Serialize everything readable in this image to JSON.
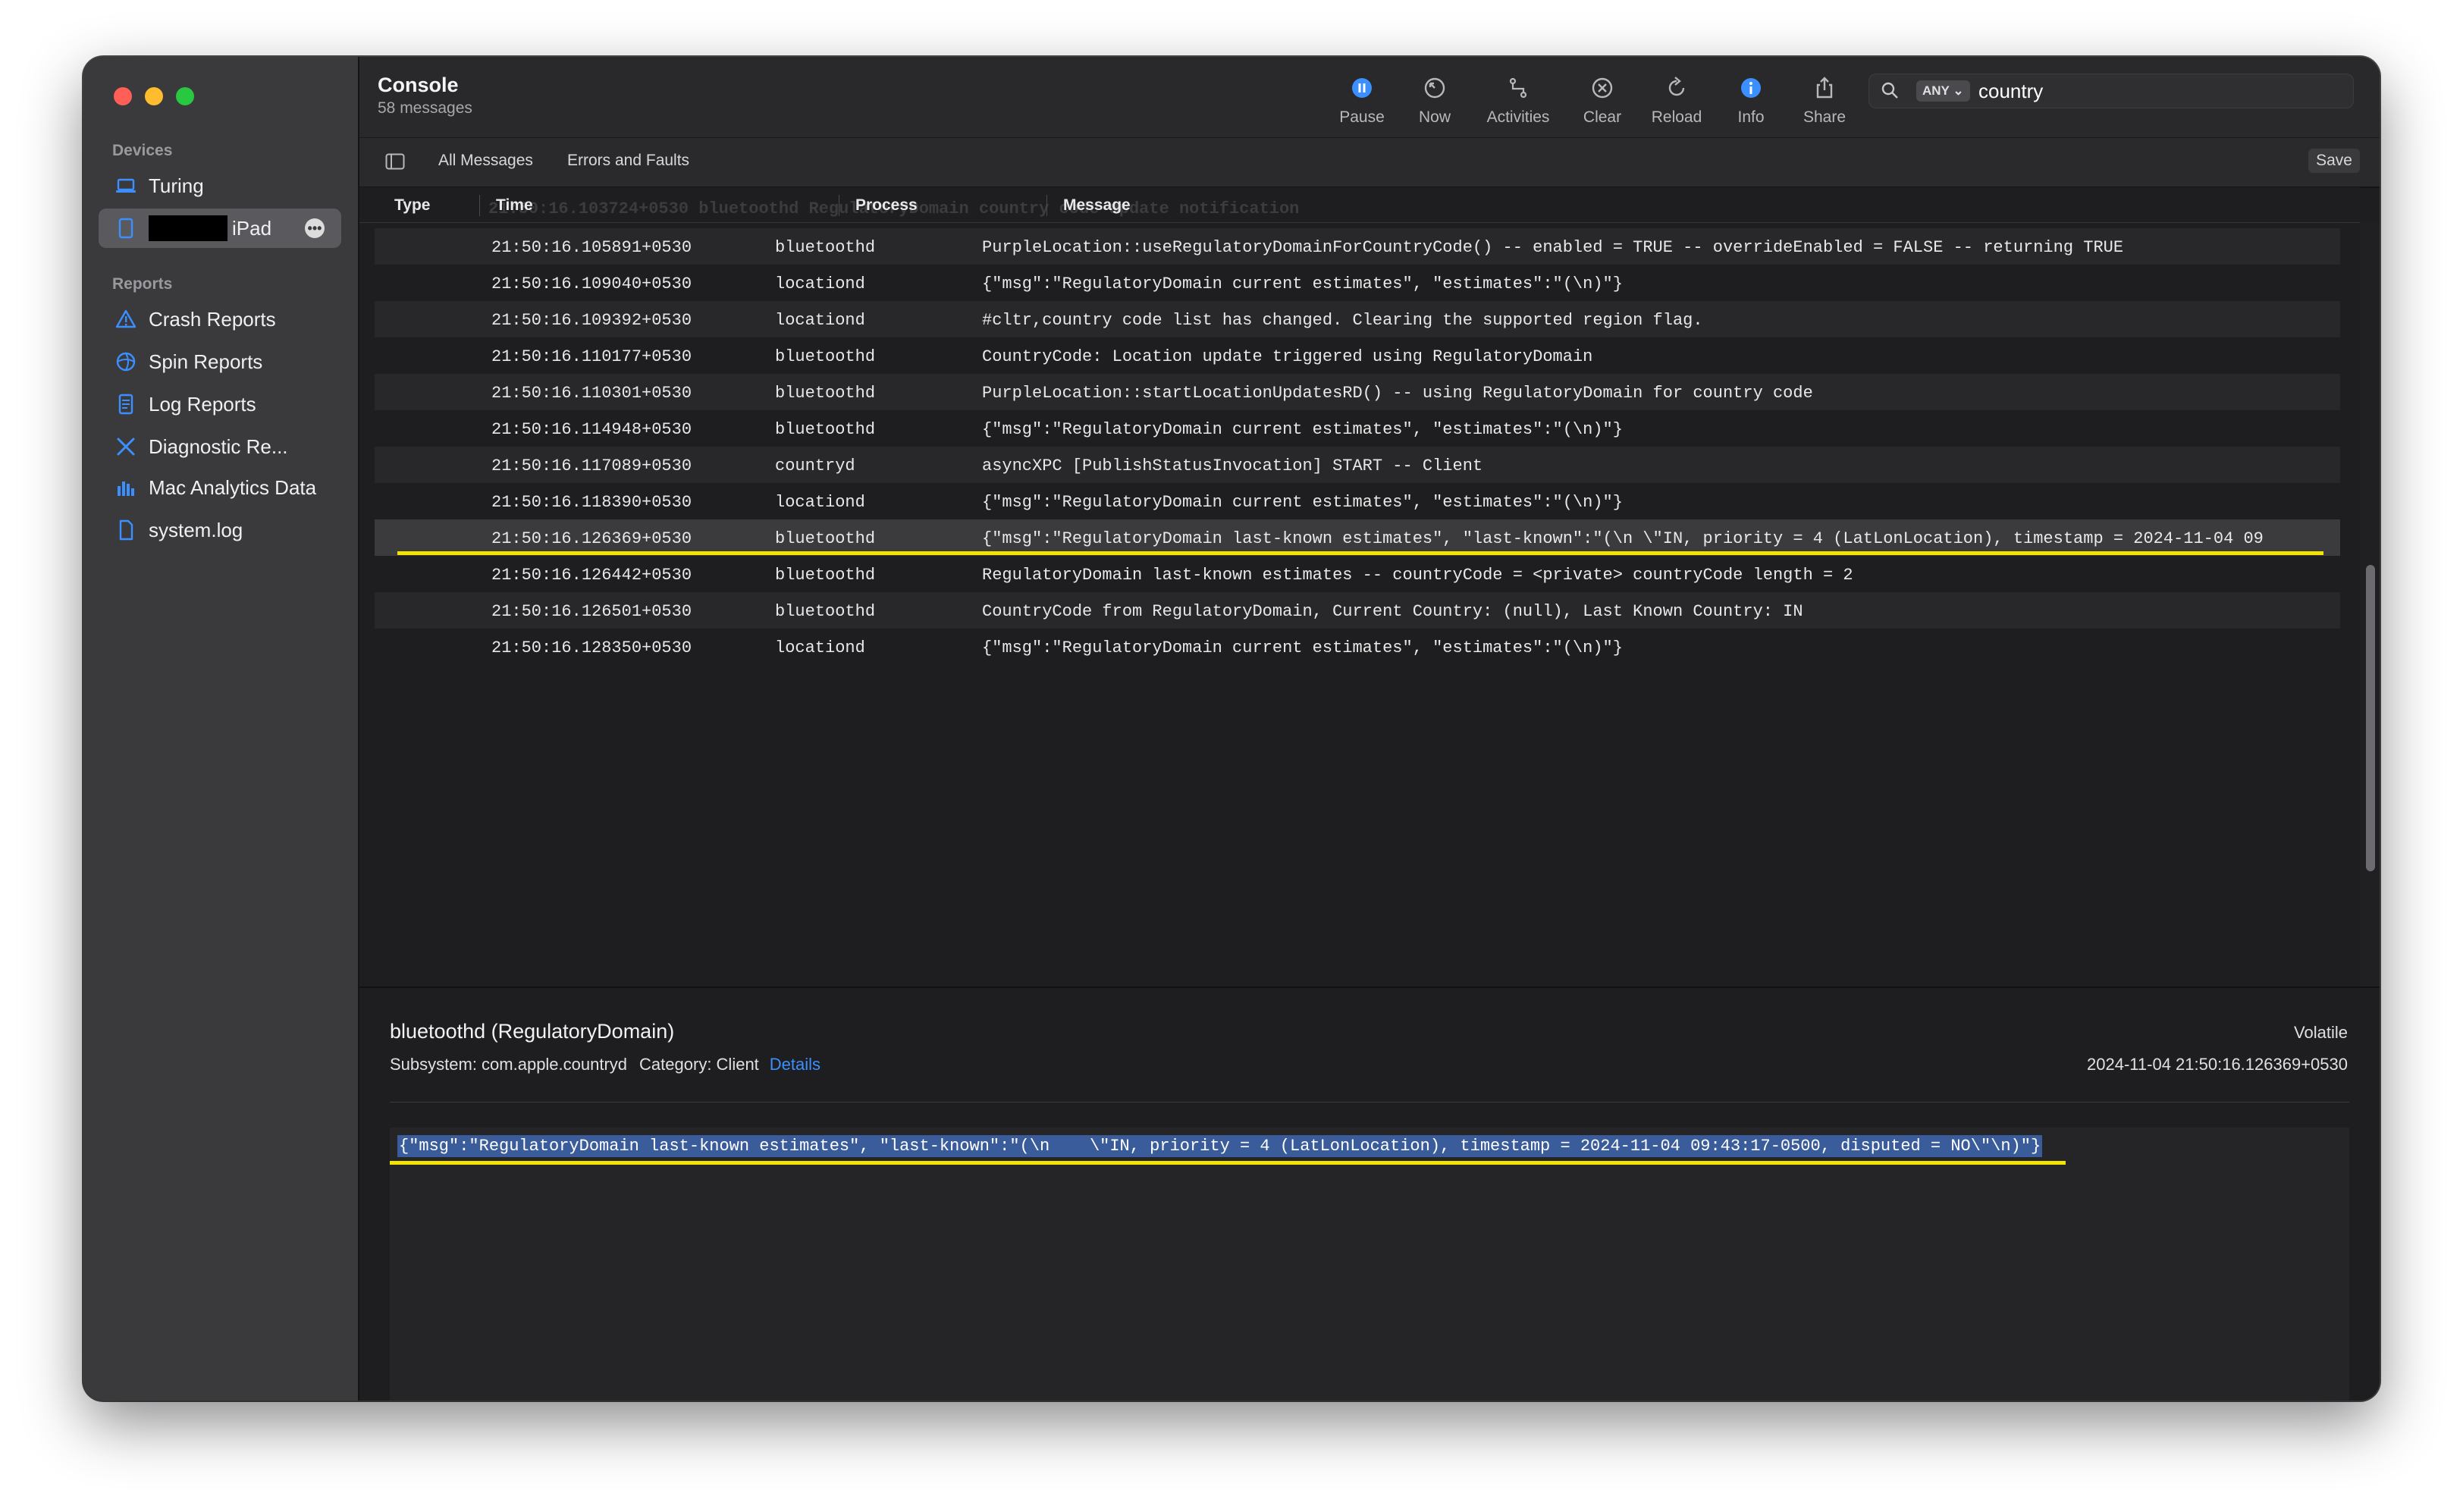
{
  "sidebar": {
    "devices_heading": "Devices",
    "devices": [
      {
        "label": "Turing",
        "icon": "laptop-icon"
      },
      {
        "label": "iPad",
        "icon": "ipad-icon"
      }
    ],
    "reports_heading": "Reports",
    "reports": [
      {
        "label": "Crash Reports",
        "icon": "warning-triangle-icon"
      },
      {
        "label": "Spin Reports",
        "icon": "spin-icon"
      },
      {
        "label": "Log Reports",
        "icon": "document-icon"
      },
      {
        "label": "Diagnostic Re...",
        "icon": "tools-icon"
      },
      {
        "label": "Mac Analytics Data",
        "icon": "bar-chart-icon"
      },
      {
        "label": "system.log",
        "icon": "file-icon"
      }
    ]
  },
  "toolbar": {
    "title": "Console",
    "subtitle": "58 messages",
    "buttons": [
      {
        "label": "Pause",
        "icon": "pause-icon"
      },
      {
        "label": "Now",
        "icon": "now-icon"
      },
      {
        "label": "Activities",
        "icon": "activities-icon"
      },
      {
        "label": "Clear",
        "icon": "clear-icon"
      },
      {
        "label": "Reload",
        "icon": "reload-icon"
      },
      {
        "label": "Info",
        "icon": "info-icon"
      },
      {
        "label": "Share",
        "icon": "share-icon"
      }
    ],
    "search": {
      "scope": "ANY",
      "query": "country"
    }
  },
  "filters": {
    "all": "All Messages",
    "errors": "Errors and Faults",
    "save": "Save"
  },
  "columns": {
    "type": "Type",
    "time": "Time",
    "process": "Process",
    "message": "Message"
  },
  "ghost_row": "21:50:16.103724+0530      bluetoothd                RegulatoryDomain country code update notification",
  "rows": [
    {
      "time": "21:50:16.105891+0530",
      "process": "bluetoothd",
      "message": "PurpleLocation::useRegulatoryDomainForCountryCode() -- enabled = TRUE -- overrideEnabled = FALSE -- returning TRUE"
    },
    {
      "time": "21:50:16.109040+0530",
      "process": "locationd",
      "message": "{\"msg\":\"RegulatoryDomain current estimates\", \"estimates\":\"(\\n)\"}"
    },
    {
      "time": "21:50:16.109392+0530",
      "process": "locationd",
      "message": "#cltr,country code list has changed. Clearing the supported region flag."
    },
    {
      "time": "21:50:16.110177+0530",
      "process": "bluetoothd",
      "message": "CountryCode: Location update triggered using RegulatoryDomain"
    },
    {
      "time": "21:50:16.110301+0530",
      "process": "bluetoothd",
      "message": "PurpleLocation::startLocationUpdatesRD() -- using RegulatoryDomain for country code"
    },
    {
      "time": "21:50:16.114948+0530",
      "process": "bluetoothd",
      "message": "{\"msg\":\"RegulatoryDomain current estimates\", \"estimates\":\"(\\n)\"}"
    },
    {
      "time": "21:50:16.117089+0530",
      "process": "countryd",
      "message": "asyncXPC [PublishStatusInvocation] START -- Client"
    },
    {
      "time": "21:50:16.118390+0530",
      "process": "locationd",
      "message": "{\"msg\":\"RegulatoryDomain current estimates\", \"estimates\":\"(\\n)\"}"
    },
    {
      "time": "21:50:16.126369+0530",
      "process": "bluetoothd",
      "message": "{\"msg\":\"RegulatoryDomain last-known estimates\", \"last-known\":\"(\\n    \\\"IN, priority = 4 (LatLonLocation), timestamp = 2024-11-04 09"
    },
    {
      "time": "21:50:16.126442+0530",
      "process": "bluetoothd",
      "message": "RegulatoryDomain last-known estimates -- countryCode = <private> countryCode length = 2"
    },
    {
      "time": "21:50:16.126501+0530",
      "process": "bluetoothd",
      "message": "CountryCode from RegulatoryDomain, Current Country: (null), Last Known Country: IN"
    },
    {
      "time": "21:50:16.128350+0530",
      "process": "locationd",
      "message": "{\"msg\":\"RegulatoryDomain current estimates\", \"estimates\":\"(\\n)\"}"
    }
  ],
  "detail": {
    "title": "bluetoothd (RegulatoryDomain)",
    "subsystem": "Subsystem: com.apple.countryd",
    "category": "Category: Client",
    "details_link": "Details",
    "volatile": "Volatile",
    "timestamp": "2024-11-04 21:50:16.126369+0530",
    "message": "{\"msg\":\"RegulatoryDomain last-known estimates\", \"last-known\":\"(\\n    \\\"IN, priority = 4 (LatLonLocation), timestamp = 2024-11-04 09:43:17-0500, disputed = NO\\\"\\n)\"}"
  },
  "colors": {
    "accent": "#3b8fff",
    "highlight": "#f2e300",
    "selection": "#3a5c9a"
  }
}
